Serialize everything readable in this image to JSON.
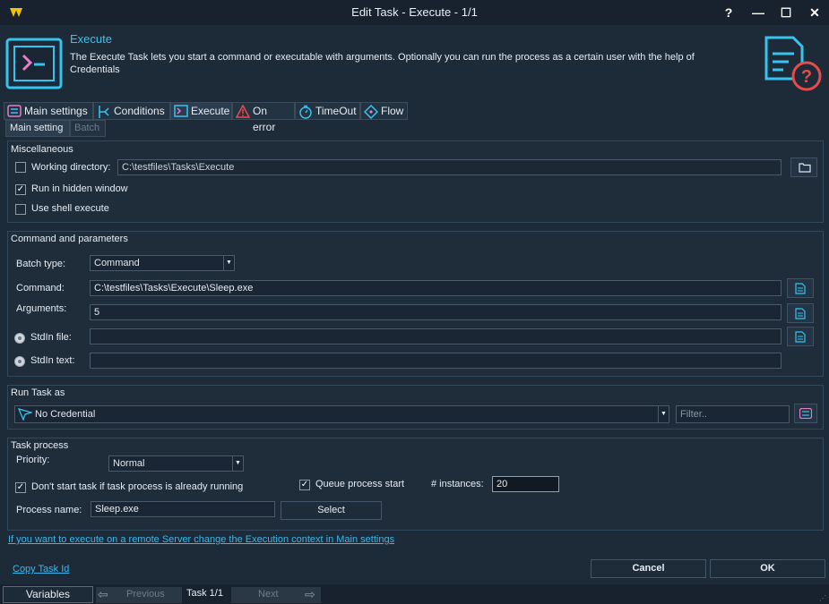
{
  "window": {
    "title": "Edit Task - Execute - 1/1",
    "help": "?",
    "minimize": "—",
    "maximize": "☐",
    "close": "✕"
  },
  "header": {
    "title": "Execute",
    "description": "The Execute Task lets you start a command or executable with arguments. Optionally you can run the process as a certain user with the help of Credentials"
  },
  "tabs": [
    {
      "label": "Main settings",
      "icon": "sliders-icon"
    },
    {
      "label": "Conditions",
      "icon": "branch-icon"
    },
    {
      "label": "Execute",
      "icon": "terminal-icon"
    },
    {
      "label": "On error",
      "icon": "warning-icon"
    },
    {
      "label": "TimeOut",
      "icon": "stopwatch-icon"
    },
    {
      "label": "Flow",
      "icon": "flow-icon"
    }
  ],
  "subtabs": [
    {
      "label": "Main setting"
    },
    {
      "label": "Batch"
    }
  ],
  "misc": {
    "title": "Miscellaneous",
    "working_dir_label": "Working directory:",
    "working_dir_value": "C:\\testfiles\\Tasks\\Execute",
    "working_dir_checked": false,
    "hidden_label": "Run in hidden window",
    "hidden_checked": true,
    "shell_label": "Use shell execute",
    "shell_checked": false
  },
  "cmd": {
    "title": "Command and parameters",
    "batch_type_label": "Batch type:",
    "batch_type_value": "Command",
    "command_label": "Command:",
    "command_value": "C:\\testfiles\\Tasks\\Execute\\Sleep.exe",
    "arguments_label": "Arguments:",
    "arguments_value": "5",
    "stdin_file_label": "StdIn file:",
    "stdin_file_value": "",
    "stdin_text_label": "StdIn text:",
    "stdin_text_value": ""
  },
  "runas": {
    "title": "Run Task as",
    "credential": "No Credential",
    "filter_placeholder": "Filter.."
  },
  "process": {
    "title": "Task process",
    "priority_label": "Priority:",
    "priority_value": "Normal",
    "dont_start_label": "Don't start task if task process is already running",
    "dont_start_checked": true,
    "queue_label": "Queue process start",
    "queue_checked": true,
    "instances_label": "# instances:",
    "instances_value": "20",
    "process_name_label": "Process name:",
    "process_name_value": "Sleep.exe",
    "select_label": "Select"
  },
  "remote_link": "If you want to execute on a remote Server change the Execution context in Main settings",
  "copy_task_id": "Copy Task Id",
  "cancel_label": "Cancel",
  "ok_label": "OK",
  "bottom": {
    "variables": "Variables",
    "previous": "Previous",
    "task_counter": "Task 1/1",
    "next": "Next"
  },
  "colors": {
    "accent": "#35c4f0",
    "background": "#1d2a37",
    "danger": "#e84b4b"
  }
}
